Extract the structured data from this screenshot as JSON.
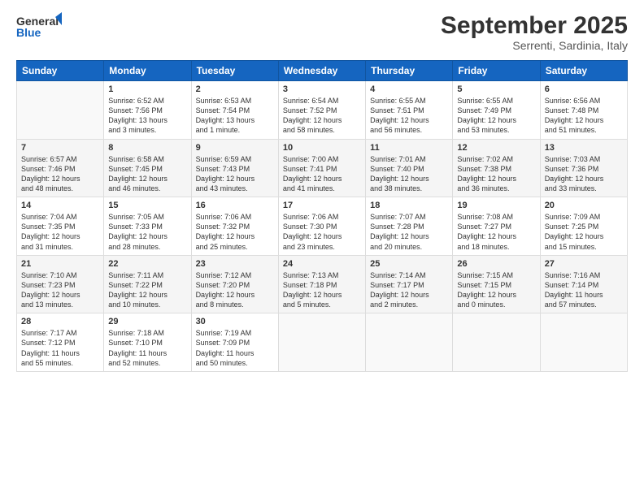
{
  "header": {
    "logo_line1": "General",
    "logo_line2": "Blue",
    "month": "September 2025",
    "location": "Serrenti, Sardinia, Italy"
  },
  "weekdays": [
    "Sunday",
    "Monday",
    "Tuesday",
    "Wednesday",
    "Thursday",
    "Friday",
    "Saturday"
  ],
  "weeks": [
    [
      {
        "day": "",
        "info": ""
      },
      {
        "day": "1",
        "info": "Sunrise: 6:52 AM\nSunset: 7:56 PM\nDaylight: 13 hours\nand 3 minutes."
      },
      {
        "day": "2",
        "info": "Sunrise: 6:53 AM\nSunset: 7:54 PM\nDaylight: 13 hours\nand 1 minute."
      },
      {
        "day": "3",
        "info": "Sunrise: 6:54 AM\nSunset: 7:52 PM\nDaylight: 12 hours\nand 58 minutes."
      },
      {
        "day": "4",
        "info": "Sunrise: 6:55 AM\nSunset: 7:51 PM\nDaylight: 12 hours\nand 56 minutes."
      },
      {
        "day": "5",
        "info": "Sunrise: 6:55 AM\nSunset: 7:49 PM\nDaylight: 12 hours\nand 53 minutes."
      },
      {
        "day": "6",
        "info": "Sunrise: 6:56 AM\nSunset: 7:48 PM\nDaylight: 12 hours\nand 51 minutes."
      }
    ],
    [
      {
        "day": "7",
        "info": "Sunrise: 6:57 AM\nSunset: 7:46 PM\nDaylight: 12 hours\nand 48 minutes."
      },
      {
        "day": "8",
        "info": "Sunrise: 6:58 AM\nSunset: 7:45 PM\nDaylight: 12 hours\nand 46 minutes."
      },
      {
        "day": "9",
        "info": "Sunrise: 6:59 AM\nSunset: 7:43 PM\nDaylight: 12 hours\nand 43 minutes."
      },
      {
        "day": "10",
        "info": "Sunrise: 7:00 AM\nSunset: 7:41 PM\nDaylight: 12 hours\nand 41 minutes."
      },
      {
        "day": "11",
        "info": "Sunrise: 7:01 AM\nSunset: 7:40 PM\nDaylight: 12 hours\nand 38 minutes."
      },
      {
        "day": "12",
        "info": "Sunrise: 7:02 AM\nSunset: 7:38 PM\nDaylight: 12 hours\nand 36 minutes."
      },
      {
        "day": "13",
        "info": "Sunrise: 7:03 AM\nSunset: 7:36 PM\nDaylight: 12 hours\nand 33 minutes."
      }
    ],
    [
      {
        "day": "14",
        "info": "Sunrise: 7:04 AM\nSunset: 7:35 PM\nDaylight: 12 hours\nand 31 minutes."
      },
      {
        "day": "15",
        "info": "Sunrise: 7:05 AM\nSunset: 7:33 PM\nDaylight: 12 hours\nand 28 minutes."
      },
      {
        "day": "16",
        "info": "Sunrise: 7:06 AM\nSunset: 7:32 PM\nDaylight: 12 hours\nand 25 minutes."
      },
      {
        "day": "17",
        "info": "Sunrise: 7:06 AM\nSunset: 7:30 PM\nDaylight: 12 hours\nand 23 minutes."
      },
      {
        "day": "18",
        "info": "Sunrise: 7:07 AM\nSunset: 7:28 PM\nDaylight: 12 hours\nand 20 minutes."
      },
      {
        "day": "19",
        "info": "Sunrise: 7:08 AM\nSunset: 7:27 PM\nDaylight: 12 hours\nand 18 minutes."
      },
      {
        "day": "20",
        "info": "Sunrise: 7:09 AM\nSunset: 7:25 PM\nDaylight: 12 hours\nand 15 minutes."
      }
    ],
    [
      {
        "day": "21",
        "info": "Sunrise: 7:10 AM\nSunset: 7:23 PM\nDaylight: 12 hours\nand 13 minutes."
      },
      {
        "day": "22",
        "info": "Sunrise: 7:11 AM\nSunset: 7:22 PM\nDaylight: 12 hours\nand 10 minutes."
      },
      {
        "day": "23",
        "info": "Sunrise: 7:12 AM\nSunset: 7:20 PM\nDaylight: 12 hours\nand 8 minutes."
      },
      {
        "day": "24",
        "info": "Sunrise: 7:13 AM\nSunset: 7:18 PM\nDaylight: 12 hours\nand 5 minutes."
      },
      {
        "day": "25",
        "info": "Sunrise: 7:14 AM\nSunset: 7:17 PM\nDaylight: 12 hours\nand 2 minutes."
      },
      {
        "day": "26",
        "info": "Sunrise: 7:15 AM\nSunset: 7:15 PM\nDaylight: 12 hours\nand 0 minutes."
      },
      {
        "day": "27",
        "info": "Sunrise: 7:16 AM\nSunset: 7:14 PM\nDaylight: 11 hours\nand 57 minutes."
      }
    ],
    [
      {
        "day": "28",
        "info": "Sunrise: 7:17 AM\nSunset: 7:12 PM\nDaylight: 11 hours\nand 55 minutes."
      },
      {
        "day": "29",
        "info": "Sunrise: 7:18 AM\nSunset: 7:10 PM\nDaylight: 11 hours\nand 52 minutes."
      },
      {
        "day": "30",
        "info": "Sunrise: 7:19 AM\nSunset: 7:09 PM\nDaylight: 11 hours\nand 50 minutes."
      },
      {
        "day": "",
        "info": ""
      },
      {
        "day": "",
        "info": ""
      },
      {
        "day": "",
        "info": ""
      },
      {
        "day": "",
        "info": ""
      }
    ]
  ]
}
